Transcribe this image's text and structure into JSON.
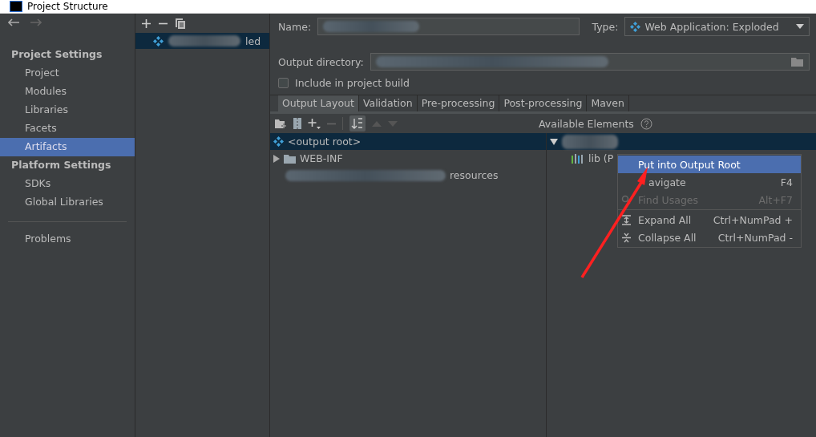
{
  "window": {
    "title": "Project Structure"
  },
  "sidebar": {
    "sections": [
      {
        "title": "Project Settings",
        "items": [
          {
            "label": "Project",
            "selected": false
          },
          {
            "label": "Modules",
            "selected": false
          },
          {
            "label": "Libraries",
            "selected": false
          },
          {
            "label": "Facets",
            "selected": false
          },
          {
            "label": "Artifacts",
            "selected": true
          }
        ]
      },
      {
        "title": "Platform Settings",
        "items": [
          {
            "label": "SDKs",
            "selected": false
          },
          {
            "label": "Global Libraries",
            "selected": false
          }
        ]
      }
    ],
    "footer_items": [
      {
        "label": "Problems",
        "selected": false
      }
    ]
  },
  "artifacts": [
    {
      "label": "led",
      "selected": true
    }
  ],
  "form": {
    "name_label": "Name:",
    "type_label": "Type:",
    "type_value": "Web Application: Exploded",
    "output_label": "Output directory:",
    "include_in_build": {
      "label": "Include in project build",
      "checked": false
    }
  },
  "tabs": [
    {
      "label": "Output Layout",
      "selected": true
    },
    {
      "label": "Validation",
      "selected": false
    },
    {
      "label": "Pre-processing",
      "selected": false
    },
    {
      "label": "Post-processing",
      "selected": false
    },
    {
      "label": "Maven",
      "selected": false
    }
  ],
  "available_label": "Available Elements",
  "layout_tree": [
    {
      "kind": "root",
      "label": "<output root>",
      "selected": true
    },
    {
      "kind": "folder",
      "label": "WEB-INF",
      "selected": false
    },
    {
      "kind": "resources",
      "label": "resources",
      "selected": false
    }
  ],
  "available_tree": [
    {
      "kind": "module",
      "selected": true
    },
    {
      "kind": "library",
      "label": "lib (P",
      "selected": false
    }
  ],
  "context_menu": [
    {
      "label": "Put into Output Root",
      "selected": true,
      "disabled": false,
      "kind": "plain"
    },
    {
      "label": "avigate",
      "shortcut": "F4",
      "selected": false,
      "disabled": false,
      "kind": "covered"
    },
    {
      "label": "Find Usages",
      "shortcut": "Alt+F7",
      "selected": false,
      "disabled": true,
      "kind": "search"
    },
    {
      "label": "Expand All",
      "shortcut": "Ctrl+NumPad +",
      "selected": false,
      "disabled": false,
      "kind": "expand"
    },
    {
      "label": "Collapse All",
      "shortcut": "Ctrl+NumPad -",
      "selected": false,
      "disabled": false,
      "kind": "collapse"
    }
  ]
}
